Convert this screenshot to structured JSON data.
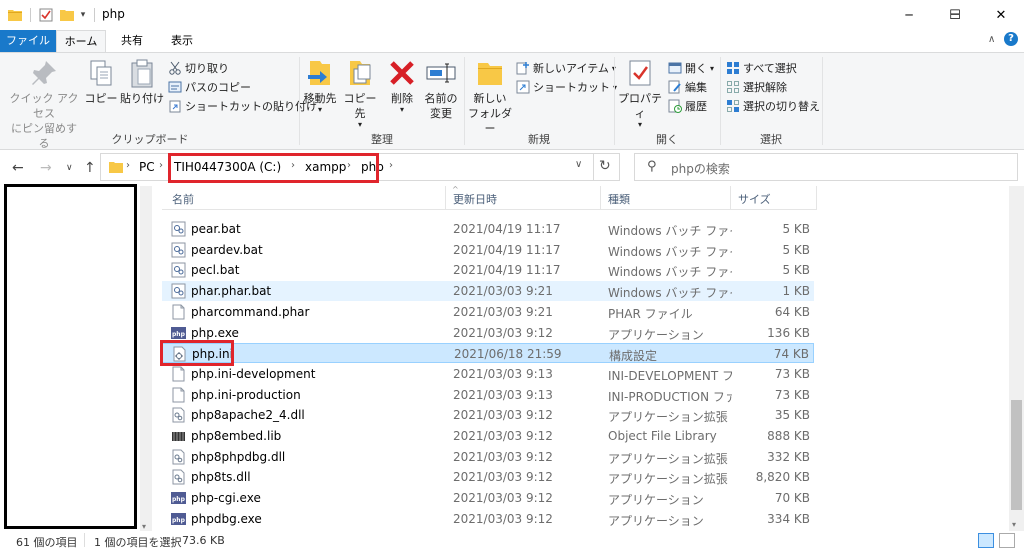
{
  "window": {
    "title": "php",
    "buttons": {
      "minimize": "─",
      "maximize": "☐",
      "close": "✕"
    }
  },
  "tabs": [
    {
      "label": "ファイル"
    },
    {
      "label": "ホーム"
    },
    {
      "label": "共有"
    },
    {
      "label": "表示"
    }
  ],
  "ribbon": {
    "clipboard": {
      "label": "クリップボード",
      "pin_line1": "クイック アクセス",
      "pin_line2": "にピン留めする",
      "copy": "コピー",
      "paste": "貼り付け",
      "cut": "切り取り",
      "copy_path": "パスのコピー",
      "paste_shortcut": "ショートカットの貼り付け"
    },
    "organize": {
      "label": "整理",
      "move_to": "移動先",
      "copy_to": "コピー先",
      "delete": "削除",
      "rename_line1": "名前の",
      "rename_line2": "変更"
    },
    "new": {
      "label": "新規",
      "new_folder_line1": "新しい",
      "new_folder_line2": "フォルダー",
      "new_item": "新しいアイテム",
      "shortcut": "ショートカット"
    },
    "open": {
      "label": "開く",
      "properties": "プロパティ",
      "open": "開く",
      "edit": "編集",
      "history": "履歴"
    },
    "select": {
      "label": "選択",
      "select_all": "すべて選択",
      "select_none": "選択解除",
      "invert": "選択の切り替え"
    }
  },
  "address": {
    "crumbs": [
      "PC",
      "TIH0447300A (C:)",
      "xampp",
      "php"
    ],
    "search_placeholder": "phpの検索"
  },
  "columns": {
    "name": "名前",
    "date": "更新日時",
    "type": "種類",
    "size": "サイズ"
  },
  "files": [
    {
      "name": "pear.bat",
      "date": "2021/04/19 11:17",
      "type": "Windows バッチ ファイル",
      "size": "5 KB",
      "icon": "bat-icon"
    },
    {
      "name": "peardev.bat",
      "date": "2021/04/19 11:17",
      "type": "Windows バッチ ファイル",
      "size": "5 KB",
      "icon": "bat-icon"
    },
    {
      "name": "pecl.bat",
      "date": "2021/04/19 11:17",
      "type": "Windows バッチ ファイル",
      "size": "5 KB",
      "icon": "bat-icon"
    },
    {
      "name": "phar.phar.bat",
      "date": "2021/03/03 9:21",
      "type": "Windows バッチ ファイル",
      "size": "1 KB",
      "icon": "bat-icon"
    },
    {
      "name": "pharcommand.phar",
      "date": "2021/03/03 9:21",
      "type": "PHAR ファイル",
      "size": "64 KB",
      "icon": "file-icon"
    },
    {
      "name": "php.exe",
      "date": "2021/03/03 9:12",
      "type": "アプリケーション",
      "size": "136 KB",
      "icon": "php-exe-icon"
    },
    {
      "name": "php.ini",
      "date": "2021/06/18 21:59",
      "type": "構成設定",
      "size": "74 KB",
      "icon": "ini-icon"
    },
    {
      "name": "php.ini-development",
      "date": "2021/03/03 9:13",
      "type": "INI-DEVELOPMENT フ...",
      "size": "73 KB",
      "icon": "file-icon"
    },
    {
      "name": "php.ini-production",
      "date": "2021/03/03 9:13",
      "type": "INI-PRODUCTION ファ...",
      "size": "73 KB",
      "icon": "file-icon"
    },
    {
      "name": "php8apache2_4.dll",
      "date": "2021/03/03 9:12",
      "type": "アプリケーション拡張",
      "size": "35 KB",
      "icon": "dll-icon"
    },
    {
      "name": "php8embed.lib",
      "date": "2021/03/03 9:12",
      "type": "Object File Library",
      "size": "888 KB",
      "icon": "lib-icon"
    },
    {
      "name": "php8phpdbg.dll",
      "date": "2021/03/03 9:12",
      "type": "アプリケーション拡張",
      "size": "332 KB",
      "icon": "dll-icon"
    },
    {
      "name": "php8ts.dll",
      "date": "2021/03/03 9:12",
      "type": "アプリケーション拡張",
      "size": "8,820 KB",
      "icon": "dll-icon"
    },
    {
      "name": "php-cgi.exe",
      "date": "2021/03/03 9:12",
      "type": "アプリケーション",
      "size": "70 KB",
      "icon": "php-exe-icon"
    },
    {
      "name": "phpdbg.exe",
      "date": "2021/03/03 9:12",
      "type": "アプリケーション",
      "size": "334 KB",
      "icon": "php-exe-icon"
    }
  ],
  "status": {
    "count": "61 個の項目",
    "selected": "1 個の項目を選択",
    "size": "73.6 KB"
  },
  "colors": {
    "accent": "#1979ca",
    "highlight": "#e0252c",
    "selection": "#cce8ff",
    "folder": "#f8c846"
  }
}
